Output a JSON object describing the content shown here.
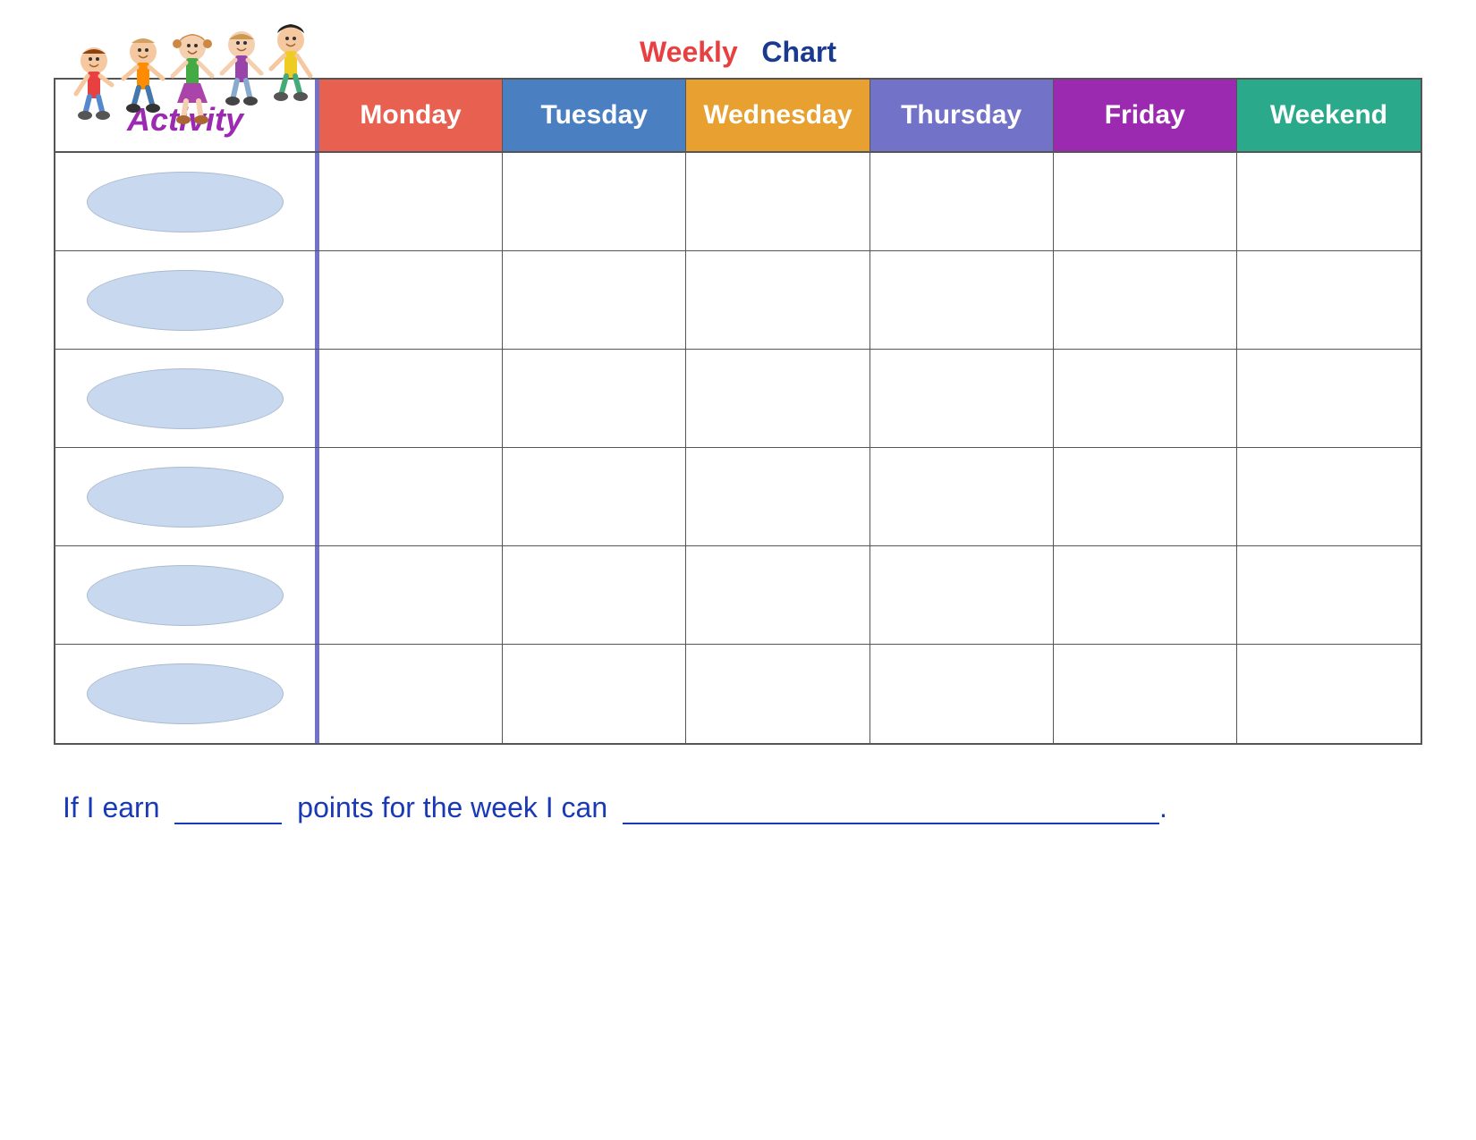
{
  "title": {
    "weekly": "Weekly",
    "chart": "Chart"
  },
  "header": {
    "activity_label": "Activity",
    "days": [
      {
        "id": "monday",
        "label": "Monday",
        "class": "day-monday"
      },
      {
        "id": "tuesday",
        "label": "Tuesday",
        "class": "day-tuesday"
      },
      {
        "id": "wednesday",
        "label": "Wednesday",
        "class": "day-wednesday"
      },
      {
        "id": "thursday",
        "label": "Thursday",
        "class": "day-thursday"
      },
      {
        "id": "friday",
        "label": "Friday",
        "class": "day-friday"
      },
      {
        "id": "weekend",
        "label": "Weekend",
        "class": "day-weekend"
      }
    ]
  },
  "rows": [
    {
      "id": 1
    },
    {
      "id": 2
    },
    {
      "id": 3
    },
    {
      "id": 4
    },
    {
      "id": 5
    },
    {
      "id": 6
    }
  ],
  "footer": {
    "text1": "If I earn",
    "text2": "points for the week I can",
    "period": "."
  },
  "colors": {
    "monday": "#e86050",
    "tuesday": "#4a7fc1",
    "wednesday": "#e8a030",
    "thursday": "#7272c8",
    "friday": "#9b2ab0",
    "weekend": "#2aaa8a",
    "activity": "#9b2ab0"
  }
}
